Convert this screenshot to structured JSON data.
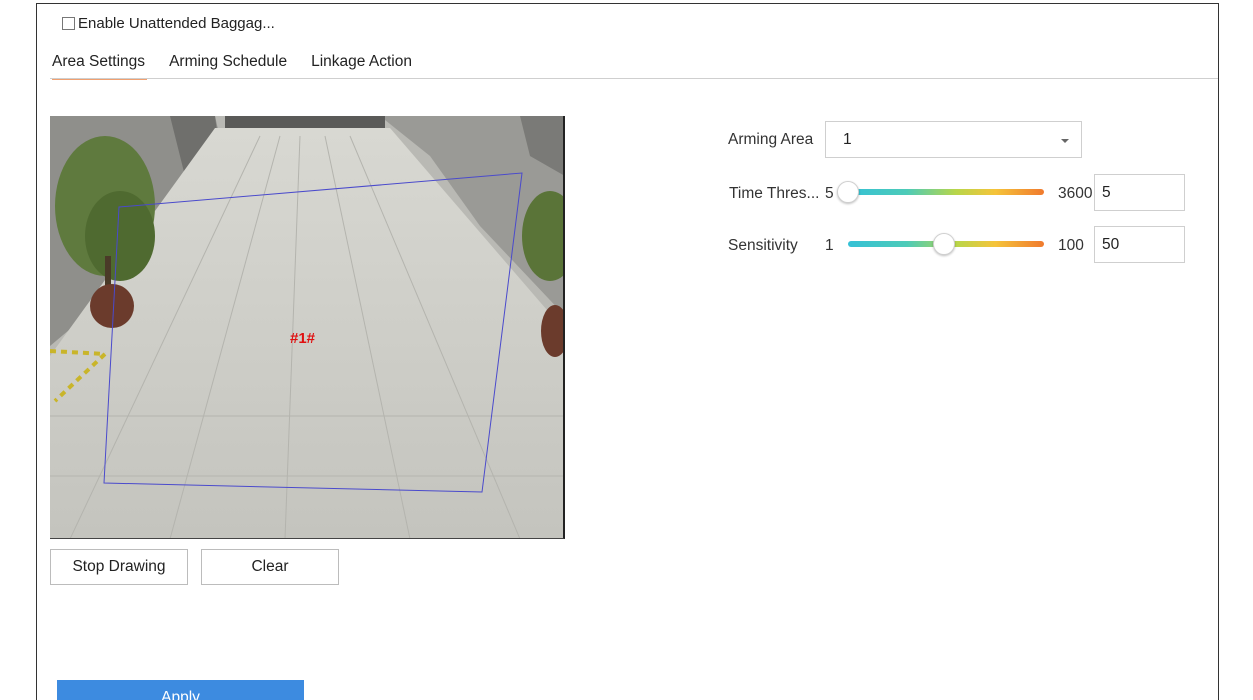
{
  "enable": {
    "label": "Enable Unattended Baggag...",
    "checked": false
  },
  "tabs": [
    {
      "label": "Area Settings",
      "active": true
    },
    {
      "label": "Arming Schedule",
      "active": false
    },
    {
      "label": "Linkage Action",
      "active": false
    }
  ],
  "preview": {
    "area_label": "#1#",
    "area_color": "#4a4acc"
  },
  "buttons": {
    "stop_drawing": "Stop Drawing",
    "clear": "Clear",
    "apply": "Apply"
  },
  "arming_area": {
    "label": "Arming Area",
    "value": "1"
  },
  "time_threshold": {
    "label": "Time Thres...",
    "min": "5",
    "max": "3600",
    "value": "5"
  },
  "sensitivity": {
    "label": "Sensitivity",
    "min": "1",
    "max": "100",
    "value": "50"
  },
  "colors": {
    "accent": "#3d8be0",
    "tab_underline": "#f0a070",
    "area_text": "#e01010"
  }
}
